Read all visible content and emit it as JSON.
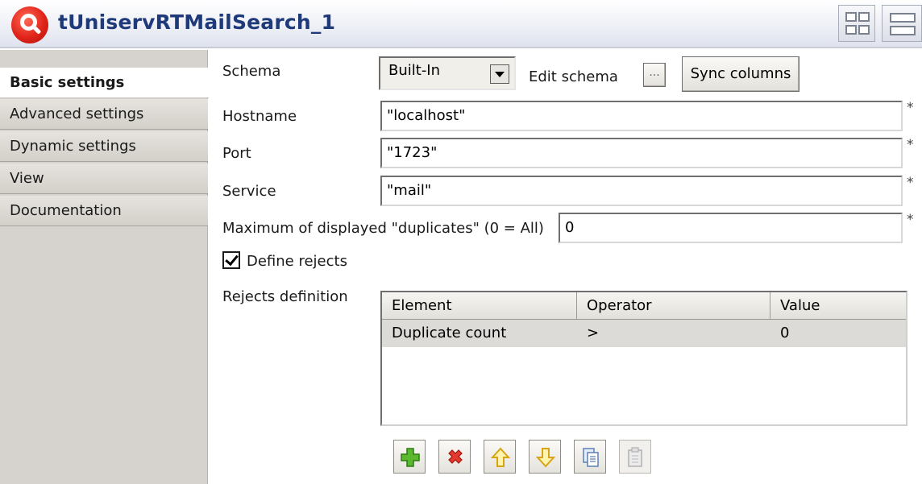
{
  "titlebar": {
    "title": "tUniservRTMailSearch_1"
  },
  "sidebar": {
    "tabs": [
      {
        "label": "Basic settings",
        "active": true
      },
      {
        "label": "Advanced settings"
      },
      {
        "label": "Dynamic settings"
      },
      {
        "label": "View"
      },
      {
        "label": "Documentation"
      }
    ]
  },
  "form": {
    "schema_label": "Schema",
    "schema_value": "Built-In",
    "edit_schema_label": "Edit schema",
    "edit_schema_button": "...",
    "sync_columns_label": "Sync columns",
    "hostname_label": "Hostname",
    "hostname_value": "\"localhost\"",
    "port_label": "Port",
    "port_value": "\"1723\"",
    "service_label": "Service",
    "service_value": "\"mail\"",
    "max_dup_label": "Maximum of displayed \"duplicates\" (0 = All)",
    "max_dup_value": "0",
    "required_mark": "*",
    "define_rejects_label": "Define rejects",
    "define_rejects_checked": true,
    "rejects_definition_label": "Rejects definition"
  },
  "rejects_table": {
    "headers": [
      "Element",
      "Operator",
      "Value"
    ],
    "rows": [
      [
        "Duplicate count",
        ">",
        "0"
      ]
    ]
  },
  "toolbar": {
    "icons": [
      "add-icon",
      "delete-icon",
      "move-up-icon",
      "move-down-icon",
      "copy-icon",
      "paste-icon"
    ]
  },
  "colors": {
    "title_text": "#1e3a7a",
    "app_icon": "#e0241a",
    "sidebar_bg": "#d6d3ce",
    "selected_row_bg": "#dddbd7"
  }
}
